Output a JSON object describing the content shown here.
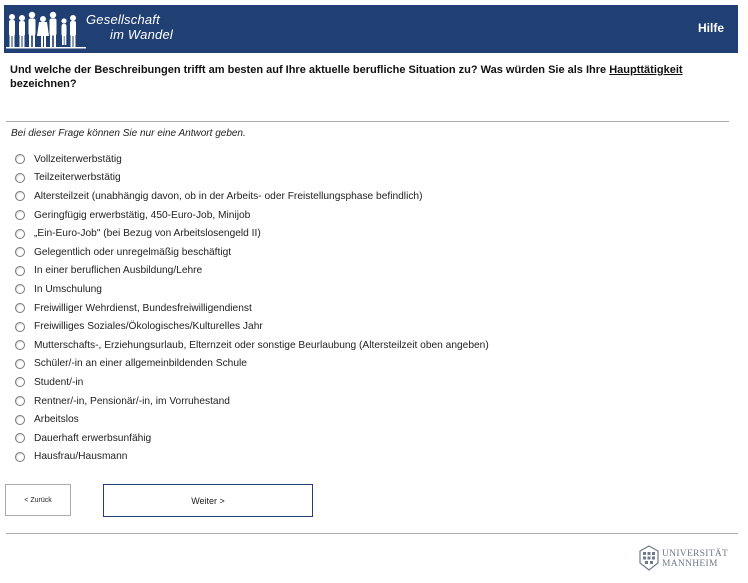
{
  "header": {
    "logo_line1": "Gesellschaft",
    "logo_line2": "im Wandel",
    "help_label": "Hilfe",
    "background_color": "#203f73"
  },
  "question": {
    "text_before": "Und welche der Beschreibungen trifft am besten auf Ihre aktuelle berufliche Situation zu? Was würden Sie als Ihre ",
    "emphasis": "Haupttätigkeit",
    "text_after": " bezeichnen?"
  },
  "instruction": "Bei dieser Frage können Sie nur eine Antwort geben.",
  "options": [
    "Vollzeiterwerbstätig",
    "Teilzeiterwerbstätig",
    "Altersteilzeit (unabhängig davon, ob in der Arbeits- oder Freistellungsphase befindlich)",
    "Geringfügig erwerbstätig, 450-Euro-Job, Minijob",
    "„Ein-Euro-Job\" (bei Bezug von Arbeitslosengeld II)",
    "Gelegentlich oder unregelmäßig beschäftigt",
    "In einer beruflichen Ausbildung/Lehre",
    "In Umschulung",
    "Freiwilliger Wehrdienst, Bundesfreiwilligendienst",
    "Freiwilliges Soziales/Ökologisches/Kulturelles Jahr",
    "Mutterschafts-, Erziehungsurlaub, Elternzeit oder sonstige Beurlaubung (Altersteilzeit oben angeben)",
    "Schüler/-in an einer allgemeinbildenden Schule",
    "Student/-in",
    "Rentner/-in, Pensionär/-in, im Vorruhestand",
    "Arbeitslos",
    "Dauerhaft erwerbsunfähig",
    "Hausfrau/Hausmann"
  ],
  "navigation": {
    "back_label": "< Zurück",
    "next_label": "Weiter >"
  },
  "footer": {
    "university_line1": "UNIVERSITÄT",
    "university_line2": "MANNHEIM"
  },
  "icons": {
    "logo_figures": "people-silhouettes-icon",
    "university_emblem": "university-emblem-icon",
    "radio": "radio-button-icon"
  }
}
